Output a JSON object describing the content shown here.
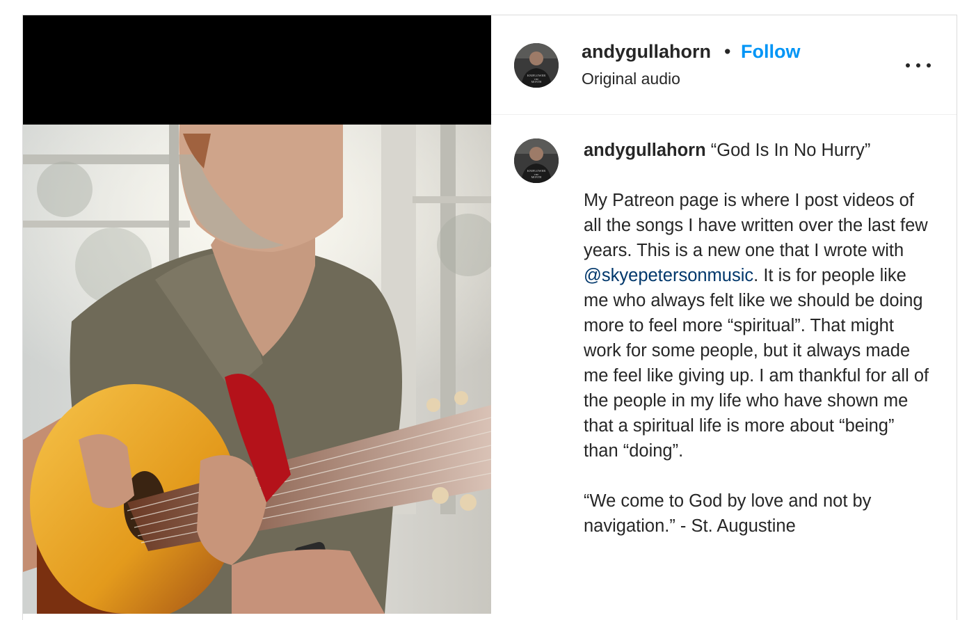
{
  "post": {
    "username": "andygullahorn",
    "separator": "•",
    "follow_label": "Follow",
    "audio_label": "Original audio",
    "more_icon": "more-horizontal-icon"
  },
  "caption": {
    "username": "andygullahorn",
    "title": "“God Is In No Hurry”",
    "body_before_mention": "My Patreon page is where I post videos of all the songs I have written over the last few years. This is a new one that I wrote with",
    "mention": "@skyepetersonmusic",
    "body_after_mention": ". It is for people like me who always felt like we should be doing more to feel more “spiritual”. That might work for some people, but it always made me feel like giving up. I am thankful for all of the people in my life who have shown me that a spiritual life is more about “being” than “doing”.",
    "quote": "“We come to God by love and not by navigation.” - St. Augustine"
  },
  "avatar_shirt_text": [
    "KNIFLOWER",
    "THE",
    "MONTH"
  ],
  "colors": {
    "follow": "#0095f6",
    "mention": "#00376b",
    "text": "#262626"
  }
}
